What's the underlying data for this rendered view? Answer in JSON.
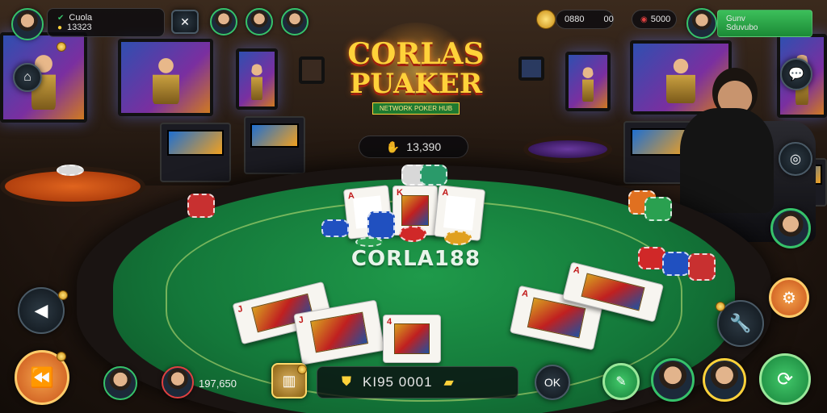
{
  "logo": {
    "line1": "CORLAS",
    "line2": "PUAKER",
    "ribbon": "NETWORK POKER HUB"
  },
  "table": {
    "brand": "CORLA188"
  },
  "pot": {
    "icon": "chip-hand-icon",
    "value": "13,390"
  },
  "top_left_player": {
    "name": "Cuola",
    "balance": "13323"
  },
  "top_right_stats": {
    "left": "0880",
    "middle": "00",
    "right": "5000"
  },
  "top_right_player": {
    "line1": "Gunv",
    "line2": "Sduvubo"
  },
  "bottom_bar": {
    "player_amount": "197,650",
    "balance": "KI95 0001"
  },
  "colors": {
    "felt": "#14783a",
    "accent_gold": "#ffd23a",
    "accent_green": "#36c26a",
    "action_orange": "#e0641e"
  },
  "icons": {
    "back": "back-arrow-icon",
    "rewind": "rewind-icon",
    "settings": "gear-icon",
    "camera": "camera-icon",
    "chat": "chat-bubble-icon",
    "tools": "wrench-icon",
    "home": "home-icon",
    "share": "share-icon",
    "vault": "vault-icon",
    "bank": "gold-bar-icon"
  }
}
